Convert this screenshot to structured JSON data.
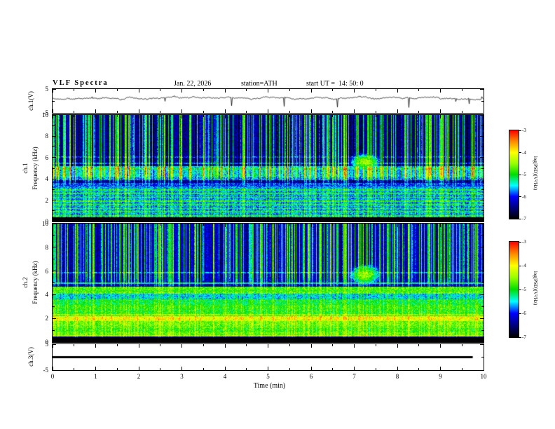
{
  "header": {
    "title": "VLF Spectra",
    "date": "Jan. 22, 2026",
    "station": "station=ATH",
    "start_ut": "start UT =  14: 50: 0"
  },
  "xaxis": {
    "label": "Time (min)",
    "min": 0,
    "max": 10,
    "major_ticks": [
      0,
      1,
      2,
      3,
      4,
      5,
      6,
      7,
      8,
      9,
      10
    ]
  },
  "colorbar": {
    "label": "log(PSD)(V²/Hz)",
    "min": -7,
    "max": -3,
    "ticks": [
      -3,
      -4,
      -5,
      -6,
      -7
    ],
    "stops": [
      "#000000",
      "#000080",
      "#0000ff",
      "#00ffff",
      "#00dd00",
      "#99ff00",
      "#ffff00",
      "#ff8800",
      "#ff0000"
    ]
  },
  "panels": {
    "wave1": {
      "ylabel": "ch.1(V)",
      "ymin": -5,
      "ymax": 5,
      "yticks": [
        5,
        -5
      ],
      "ytick_marks": [
        5,
        0,
        -5
      ]
    },
    "spec1": {
      "ylabel_ch": "ch.1",
      "ylabel_axis": "Frequency (kHz)",
      "ymin": 0,
      "ymax": 10,
      "yticks": [
        10,
        8,
        6,
        4,
        2,
        0
      ]
    },
    "spec2": {
      "ylabel_ch": "ch.2",
      "ylabel_axis": "Frequency (kHz)",
      "ymin": 0,
      "ymax": 10,
      "yticks": [
        10,
        8,
        6,
        4,
        2,
        0
      ]
    },
    "wave3": {
      "ylabel": "ch.3(V)",
      "ymin": -5,
      "ymax": 5,
      "yticks": [
        5,
        -5
      ],
      "ytick_marks": [
        5,
        0,
        -5
      ]
    }
  },
  "chart_data": [
    {
      "id": "ch1-voltage",
      "type": "line",
      "panel": "wave1",
      "seed": 101,
      "xlim": [
        0,
        10
      ],
      "ylim": [
        -5,
        5
      ],
      "mean_level": 1.2,
      "noise_amplitude": 0.35,
      "spike_down_rate": 0.012,
      "spike_up_rate": 0.006,
      "description": "ch.1 broadband voltage: jittery trace near +1 V with frequent narrow downward spikes to about -3 V"
    },
    {
      "id": "ch1-spectrogram",
      "type": "heatmap",
      "panel": "spec1",
      "seed": 202,
      "xlim": [
        0,
        10
      ],
      "ylim": [
        0,
        10
      ],
      "zlim": [
        -7,
        -3
      ],
      "background_level": -6.55,
      "noise": 0.5,
      "black_below": 0.45,
      "bands": [
        {
          "f": 4.7,
          "hw": 0.55,
          "level": -5.55
        },
        {
          "f": 4.2,
          "hw": 0.3,
          "level": -5.8
        },
        {
          "f": 1.85,
          "hw": 1.45,
          "level": -5.75
        },
        {
          "f": 3.4,
          "hw": 0.25,
          "level": -6.0
        }
      ],
      "lines": [
        {
          "f": 0.55,
          "hw": 0.06,
          "level": -5.0
        },
        {
          "f": 0.95,
          "hw": 0.06,
          "level": -5.1
        },
        {
          "f": 1.25,
          "hw": 0.05,
          "level": -5.0
        },
        {
          "f": 1.6,
          "hw": 0.05,
          "level": -5.1
        },
        {
          "f": 1.95,
          "hw": 0.05,
          "level": -5.0
        },
        {
          "f": 2.3,
          "hw": 0.05,
          "level": -5.05
        },
        {
          "f": 2.65,
          "hw": 0.05,
          "level": -5.1
        },
        {
          "f": 3.0,
          "hw": 0.05,
          "level": -5.15
        },
        {
          "f": 4.95,
          "hw": 0.07,
          "level": -5.2
        },
        {
          "f": 5.5,
          "hw": 0.06,
          "level": -5.9
        },
        {
          "f": 6.1,
          "hw": 0.05,
          "level": -6.1
        }
      ],
      "streaks": {
        "density": 0.42,
        "max_boost": 2.1,
        "fmin": 3.2,
        "below_factor": 0.3
      },
      "blob": {
        "x": 7.25,
        "f": 5.6,
        "sx": 0.33,
        "sf": 0.75,
        "level": -4.35
      },
      "description": "ch.1 spectrogram: dense vertical sferic streaks above ~3.5 kHz, horizontal banded structure below 3 kHz, black quiet band below ~0.45 kHz, localized green emission near 7.25 min at 5-6 kHz"
    },
    {
      "id": "ch2-spectrogram",
      "type": "heatmap",
      "panel": "spec2",
      "seed": 303,
      "xlim": [
        0,
        10
      ],
      "ylim": [
        0,
        10
      ],
      "zlim": [
        -7,
        -3
      ],
      "background_level": -6.35,
      "noise": 0.5,
      "black_below": 0.45,
      "bands": [
        {
          "f": 2.05,
          "hw": 0.17,
          "level": -4.15
        },
        {
          "f": 1.6,
          "hw": 0.22,
          "level": -4.7
        },
        {
          "f": 2.6,
          "hw": 0.55,
          "level": -5.0
        },
        {
          "f": 3.3,
          "hw": 0.35,
          "level": -5.15
        },
        {
          "f": 1.05,
          "hw": 0.35,
          "level": -4.9
        },
        {
          "f": 4.4,
          "hw": 0.28,
          "level": -4.85
        },
        {
          "f": 3.85,
          "hw": 0.25,
          "level": -5.6
        },
        {
          "f": 0.7,
          "hw": 0.18,
          "level": -4.8
        }
      ],
      "lines": [
        {
          "f": 0.55,
          "hw": 0.05,
          "level": -4.5
        },
        {
          "f": 1.3,
          "hw": 0.05,
          "level": -4.6
        },
        {
          "f": 1.85,
          "hw": 0.05,
          "level": -4.4
        },
        {
          "f": 2.35,
          "hw": 0.05,
          "level": -4.6
        },
        {
          "f": 2.9,
          "hw": 0.05,
          "level": -4.9
        },
        {
          "f": 3.55,
          "hw": 0.05,
          "level": -5.1
        },
        {
          "f": 5.0,
          "hw": 0.06,
          "level": -5.4
        },
        {
          "f": 5.9,
          "hw": 0.05,
          "level": -5.8
        }
      ],
      "streaks": {
        "density": 0.42,
        "max_boost": 1.9,
        "fmin": 4.3,
        "below_factor": 0.25
      },
      "blob": {
        "x": 7.25,
        "f": 5.7,
        "sx": 0.35,
        "sf": 0.85,
        "level": -4.4
      },
      "description": "ch.2 spectrogram: vertical sferic streaks above ~4.5 kHz, strong yellow/green horizontal bands below 4.5 kHz (brightest near 2 kHz), black quiet band below ~0.45 kHz, green emission near 7.25 min at 5-6 kHz"
    },
    {
      "id": "ch3-voltage",
      "type": "flat",
      "panel": "wave3",
      "xlim": [
        0,
        10
      ],
      "ylim": [
        -5,
        5
      ],
      "value": 0,
      "thickness": 3,
      "description": "ch.3 voltage: constant 0 V flat thick black line"
    }
  ]
}
